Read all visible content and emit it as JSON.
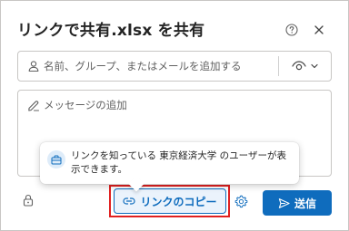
{
  "dialog": {
    "title": "リンクで共有.xlsx を共有"
  },
  "people": {
    "placeholder": "名前、グループ、またはメールを追加する"
  },
  "message": {
    "placeholder": "メッセージの追加"
  },
  "tooltip": {
    "text": "リンクを知っている 東京経済大学 のユーザーが表示できます。"
  },
  "footer": {
    "copy_link_label": "リンクのコピー",
    "send_label": "送信"
  },
  "icons": {
    "help": "help-icon",
    "close": "close-icon",
    "person": "person-icon",
    "eye": "eye-icon",
    "chevron": "chevron-down-icon",
    "pen": "pen-icon",
    "briefcase": "briefcase-icon",
    "lock": "lock-icon",
    "link": "link-icon",
    "gear": "gear-icon",
    "send": "send-icon"
  },
  "colors": {
    "accent": "#0f6cbd",
    "highlight": "#e02020"
  }
}
